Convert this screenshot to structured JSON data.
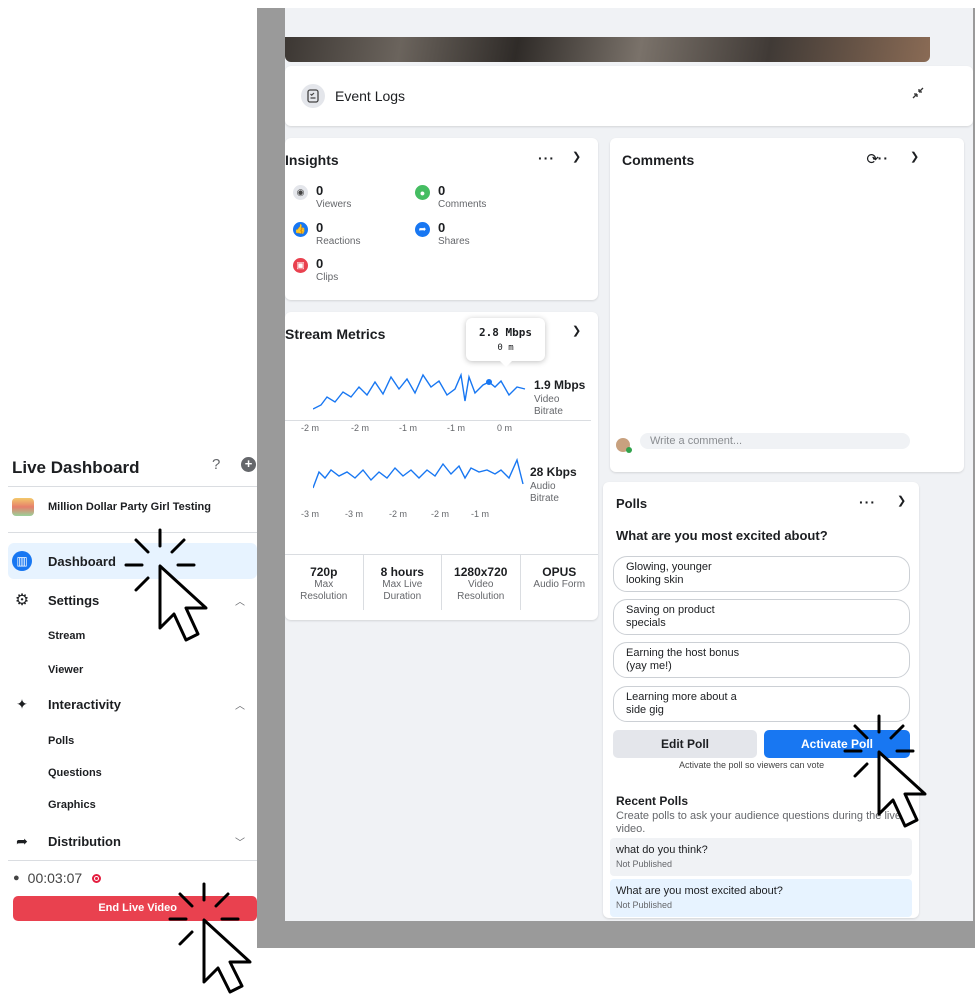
{
  "event_logs": {
    "title": "Event Logs"
  },
  "insights": {
    "title": "Insights",
    "stats": [
      {
        "value": "0",
        "label": "Viewers",
        "color": "#e4e6eb"
      },
      {
        "value": "0",
        "label": "Comments",
        "color": "#45bd62"
      },
      {
        "value": "0",
        "label": "Reactions",
        "color": "#1877f2"
      },
      {
        "value": "0",
        "label": "Shares",
        "color": "#1877f2"
      },
      {
        "value": "0",
        "label": "Clips",
        "color": "#e9414f"
      }
    ]
  },
  "stream_metrics": {
    "title": "Stream Metrics",
    "tooltip": {
      "value": "2.8 Mbps",
      "time": "0 m"
    },
    "video": {
      "value": "1.9 Mbps",
      "label1": "Video",
      "label2": "Bitrate",
      "ticks": [
        "-2 m",
        "-2 m",
        "-1 m",
        "-1 m",
        "0 m"
      ]
    },
    "audio": {
      "value": "28 Kbps",
      "label1": "Audio",
      "label2": "Bitrate",
      "ticks": [
        "-3 m",
        "-3 m",
        "-2 m",
        "-2 m",
        "-1 m"
      ]
    },
    "specs": [
      {
        "value": "720p",
        "label1": "Max",
        "label2": "Resolution"
      },
      {
        "value": "8 hours",
        "label1": "Max Live",
        "label2": "Duration"
      },
      {
        "value": "1280x720",
        "label1": "Video",
        "label2": "Resolution"
      },
      {
        "value": "OPUS",
        "label1": "Audio Form",
        "label2": ""
      }
    ]
  },
  "comments": {
    "title": "Comments",
    "placeholder": "Write a comment..."
  },
  "polls": {
    "title": "Polls",
    "question": "What are you most excited about?",
    "options": [
      [
        "Glowing, younger",
        "looking skin"
      ],
      [
        "Saving on product",
        "specials"
      ],
      [
        "Earning the host bonus",
        "(yay me!)"
      ],
      [
        "Learning more about a",
        "side gig"
      ]
    ],
    "edit_label": "Edit Poll",
    "activate_label": "Activate Poll",
    "hint": "Activate the poll so viewers can vote",
    "recent_title": "Recent Polls",
    "recent_desc": "Create polls to ask your audience questions during the live video.",
    "recent": [
      {
        "title": "what do you think?",
        "status": "Not Published",
        "bg": "#f0f2f5"
      },
      {
        "title": "What are you most excited about?",
        "status": "Not Published",
        "bg": "#e7f3ff"
      }
    ]
  },
  "sidebar": {
    "title": "Live Dashboard",
    "help": "?",
    "page_name": "Million Dollar Party Girl Testing",
    "nav": {
      "dashboard": "Dashboard",
      "settings": "Settings",
      "interactivity": "Interactivity",
      "distribution": "Distribution"
    },
    "sub": {
      "stream": "Stream",
      "viewer": "Viewer",
      "polls": "Polls",
      "questions": "Questions",
      "graphics": "Graphics"
    },
    "timer": "00:03:07",
    "end_label": "End Live Video"
  }
}
